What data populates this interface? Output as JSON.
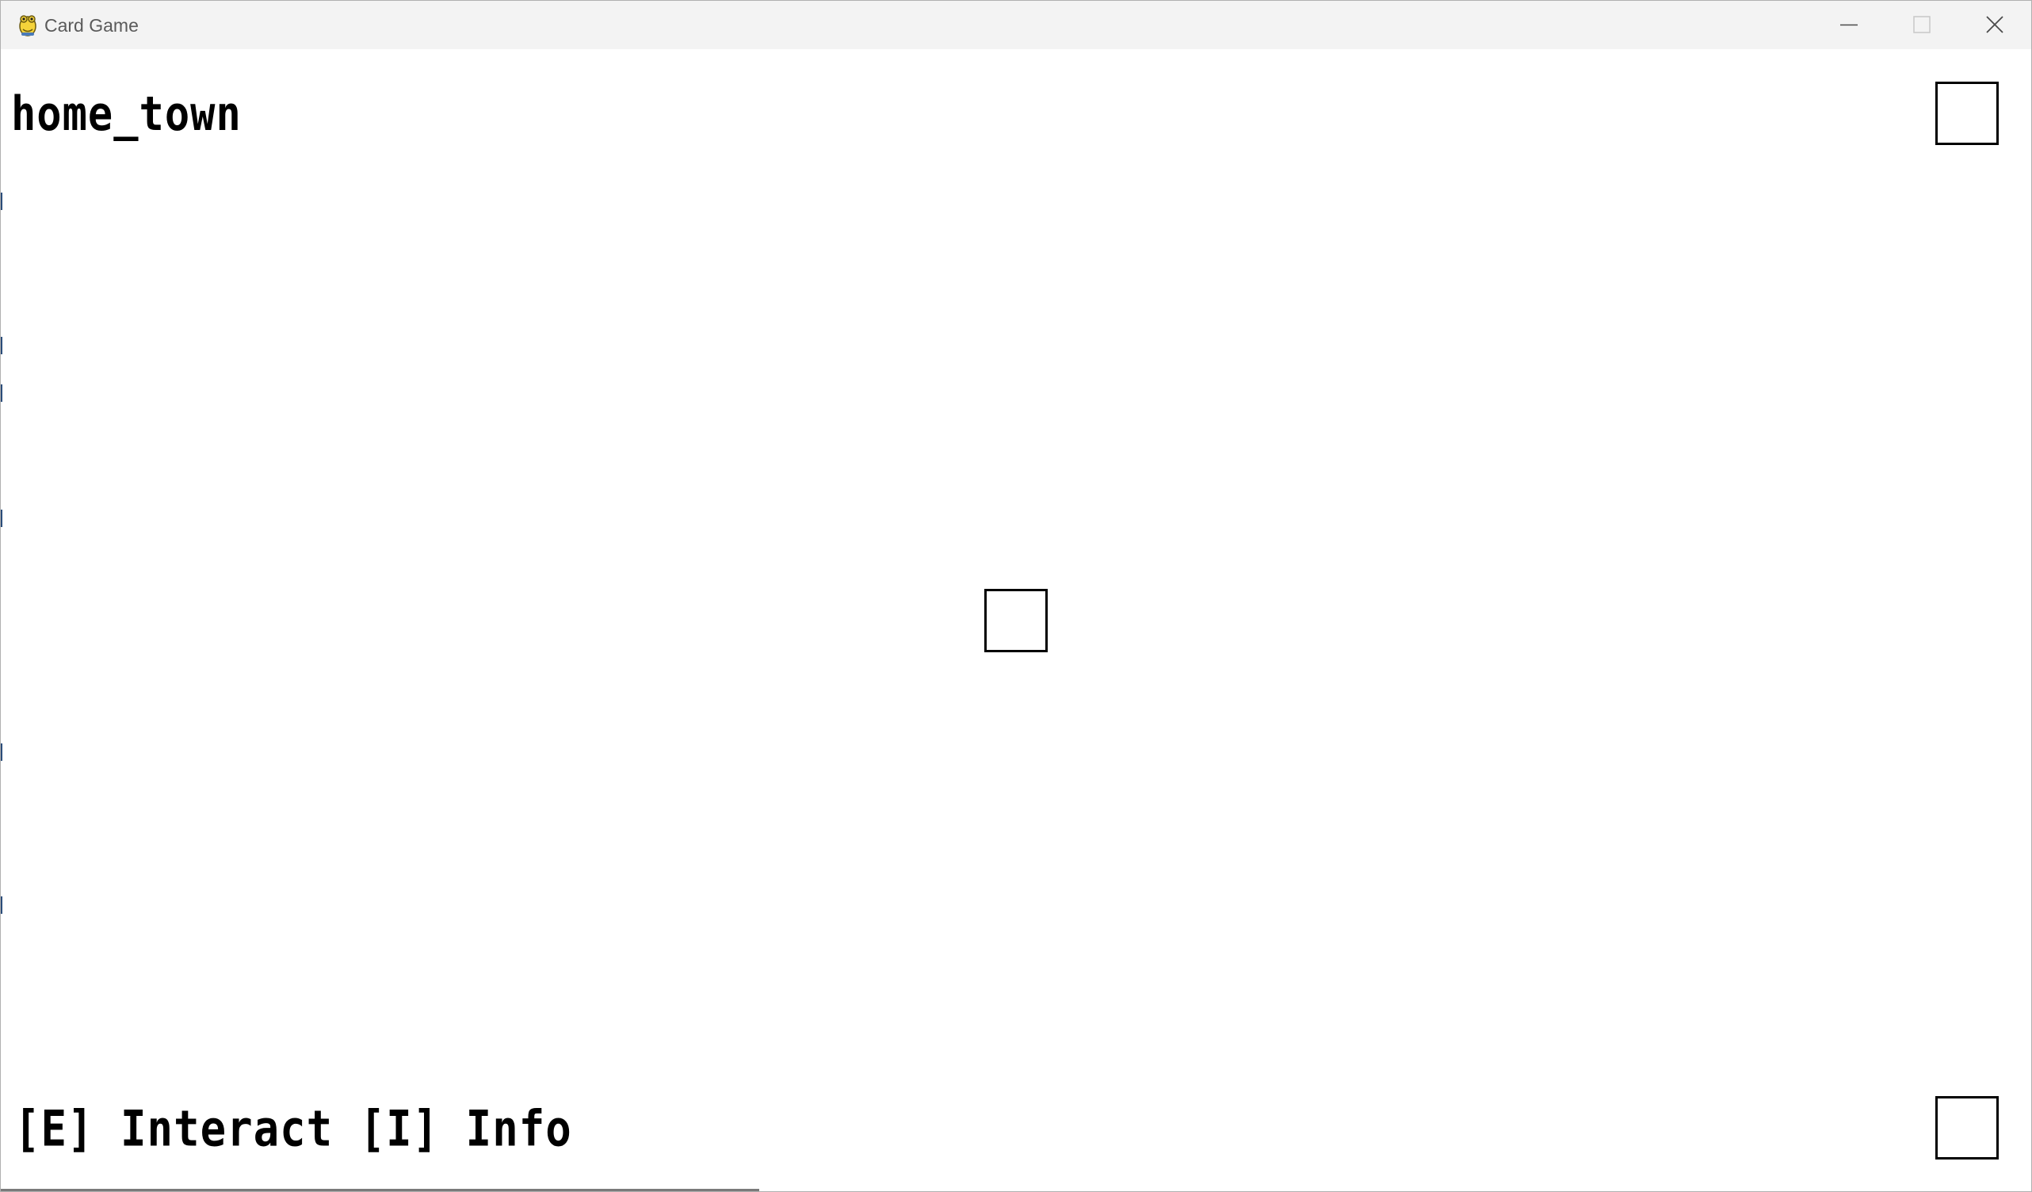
{
  "window": {
    "title": "Card Game",
    "icon": "pygame-snake-icon",
    "controls": [
      "minimize-icon",
      "maximize-icon",
      "close-icon"
    ]
  },
  "game": {
    "location": "home_town",
    "controls_hint": "[E] Interact [I] Info",
    "colors": {
      "background": "#ffffff",
      "foreground": "#000000",
      "titlebar": "#f3f3f3"
    }
  }
}
